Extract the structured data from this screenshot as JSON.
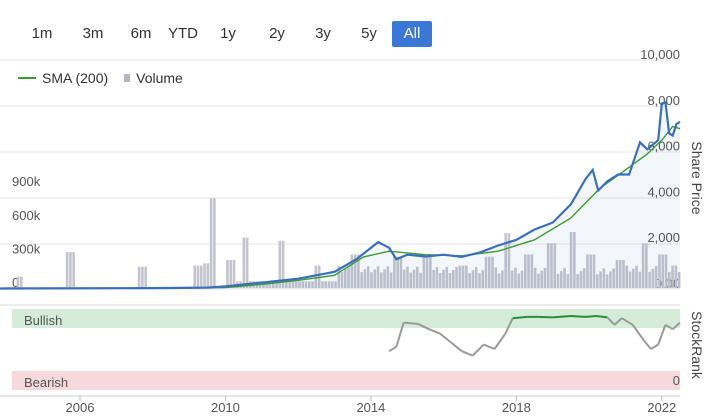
{
  "range_buttons": [
    {
      "label": "1m",
      "active": false
    },
    {
      "label": "3m",
      "active": false
    },
    {
      "label": "6m",
      "active": false
    },
    {
      "label": "YTD",
      "active": false
    },
    {
      "label": "1y",
      "active": false
    },
    {
      "label": "2y",
      "active": false
    },
    {
      "label": "3y",
      "active": false
    },
    {
      "label": "5y",
      "active": false
    },
    {
      "label": "All",
      "active": true
    }
  ],
  "legend": {
    "sma_label": "SMA (200)",
    "volume_label": "Volume"
  },
  "colors": {
    "price": "#3a6fc0",
    "sma": "#3a9d2f",
    "volume": "#c4c4ce",
    "active_button": "#3b77d6",
    "bullish_band": "#d4ecd8",
    "bearish_band": "#f7d8dc",
    "stockrank_bull": "#2e8b3a",
    "stockrank_neutral": "#9a9a9a"
  },
  "chart_data": {
    "type": "line",
    "x_ticks": [
      "2006",
      "2010",
      "2014",
      "2018",
      "2022"
    ],
    "xlim": [
      2003.8,
      2022.5
    ],
    "price_axis": {
      "title": "Share Price",
      "ticks": [
        "0.00",
        "2,000",
        "4,000",
        "6,000",
        "8,000",
        "10,000"
      ],
      "ylim": [
        0,
        10000
      ]
    },
    "volume_axis": {
      "ticks": [
        "0",
        "300k",
        "600k",
        "900k"
      ],
      "ylim": [
        0,
        1000000
      ]
    },
    "series": [
      {
        "name": "Share Price",
        "points": [
          [
            2003.8,
            20
          ],
          [
            2006,
            30
          ],
          [
            2008,
            40
          ],
          [
            2009.5,
            60
          ],
          [
            2010,
            120
          ],
          [
            2011,
            280
          ],
          [
            2012,
            450
          ],
          [
            2013,
            750
          ],
          [
            2013.6,
            1300
          ],
          [
            2014.2,
            2050
          ],
          [
            2014.5,
            1800
          ],
          [
            2014.7,
            1300
          ],
          [
            2015,
            1500
          ],
          [
            2015.5,
            1420
          ],
          [
            2016,
            1500
          ],
          [
            2016.5,
            1400
          ],
          [
            2017,
            1600
          ],
          [
            2017.5,
            1900
          ],
          [
            2018,
            2150
          ],
          [
            2018.5,
            2600
          ],
          [
            2019,
            2900
          ],
          [
            2019.5,
            3700
          ],
          [
            2019.9,
            4800
          ],
          [
            2020.1,
            5200
          ],
          [
            2020.25,
            4300
          ],
          [
            2020.5,
            4700
          ],
          [
            2020.8,
            5000
          ],
          [
            2021.1,
            5000
          ],
          [
            2021.4,
            6400
          ],
          [
            2021.6,
            6100
          ],
          [
            2021.9,
            6500
          ],
          [
            2022.0,
            8100
          ],
          [
            2022.1,
            8150
          ],
          [
            2022.2,
            6800
          ],
          [
            2022.3,
            6700
          ],
          [
            2022.4,
            7200
          ],
          [
            2022.5,
            7300
          ]
        ]
      },
      {
        "name": "SMA (200)",
        "points": [
          [
            2003.8,
            20
          ],
          [
            2008,
            30
          ],
          [
            2010,
            60
          ],
          [
            2011,
            200
          ],
          [
            2012,
            380
          ],
          [
            2013,
            600
          ],
          [
            2013.8,
            1400
          ],
          [
            2014.5,
            1650
          ],
          [
            2015.5,
            1500
          ],
          [
            2016.5,
            1450
          ],
          [
            2017.5,
            1650
          ],
          [
            2018.5,
            2150
          ],
          [
            2019.5,
            3100
          ],
          [
            2020.3,
            4400
          ],
          [
            2021,
            5200
          ],
          [
            2021.6,
            5900
          ],
          [
            2022,
            6500
          ],
          [
            2022.3,
            7100
          ],
          [
            2022.5,
            7000
          ]
        ]
      },
      {
        "name": "Volume",
        "points": [
          [
            2004.3,
            100000
          ],
          [
            2005.7,
            320000
          ],
          [
            2007.7,
            190000
          ],
          [
            2009.2,
            200000
          ],
          [
            2009.5,
            220000
          ],
          [
            2009.6,
            800000
          ],
          [
            2010.1,
            250000
          ],
          [
            2010.5,
            450000
          ],
          [
            2011.5,
            420000
          ],
          [
            2012.5,
            200000
          ],
          [
            2013.5,
            300000
          ],
          [
            2014.7,
            280000
          ],
          [
            2015.5,
            300000
          ],
          [
            2016.5,
            200000
          ],
          [
            2017.2,
            280000
          ],
          [
            2017.7,
            490000
          ],
          [
            2018.3,
            300000
          ],
          [
            2018.9,
            400000
          ],
          [
            2019.5,
            500000
          ],
          [
            2020,
            300000
          ],
          [
            2020.8,
            250000
          ],
          [
            2021.5,
            400000
          ],
          [
            2022,
            300000
          ],
          [
            2022.3,
            200000
          ]
        ]
      }
    ],
    "stockrank": {
      "labels": {
        "bullish": "Bullish",
        "bearish": "Bearish",
        "axis_title": "StockRank",
        "axis_min": "0"
      },
      "points": [
        [
          2014.5,
          20
        ],
        [
          2014.7,
          30
        ],
        [
          2014.9,
          85
        ],
        [
          2015.3,
          82
        ],
        [
          2015.6,
          70
        ],
        [
          2015.9,
          60
        ],
        [
          2016.2,
          40
        ],
        [
          2016.5,
          20
        ],
        [
          2016.8,
          10
        ],
        [
          2017.1,
          35
        ],
        [
          2017.4,
          25
        ],
        [
          2017.7,
          60
        ],
        [
          2017.9,
          95
        ],
        [
          2018.3,
          98
        ],
        [
          2018.6,
          98
        ],
        [
          2019.0,
          97
        ],
        [
          2019.5,
          100
        ],
        [
          2019.9,
          98
        ],
        [
          2020.2,
          100
        ],
        [
          2020.5,
          97
        ],
        [
          2020.7,
          80
        ],
        [
          2020.9,
          95
        ],
        [
          2021.2,
          80
        ],
        [
          2021.5,
          45
        ],
        [
          2021.7,
          25
        ],
        [
          2021.9,
          35
        ],
        [
          2022.1,
          80
        ],
        [
          2022.3,
          70
        ],
        [
          2022.5,
          85
        ]
      ]
    }
  }
}
